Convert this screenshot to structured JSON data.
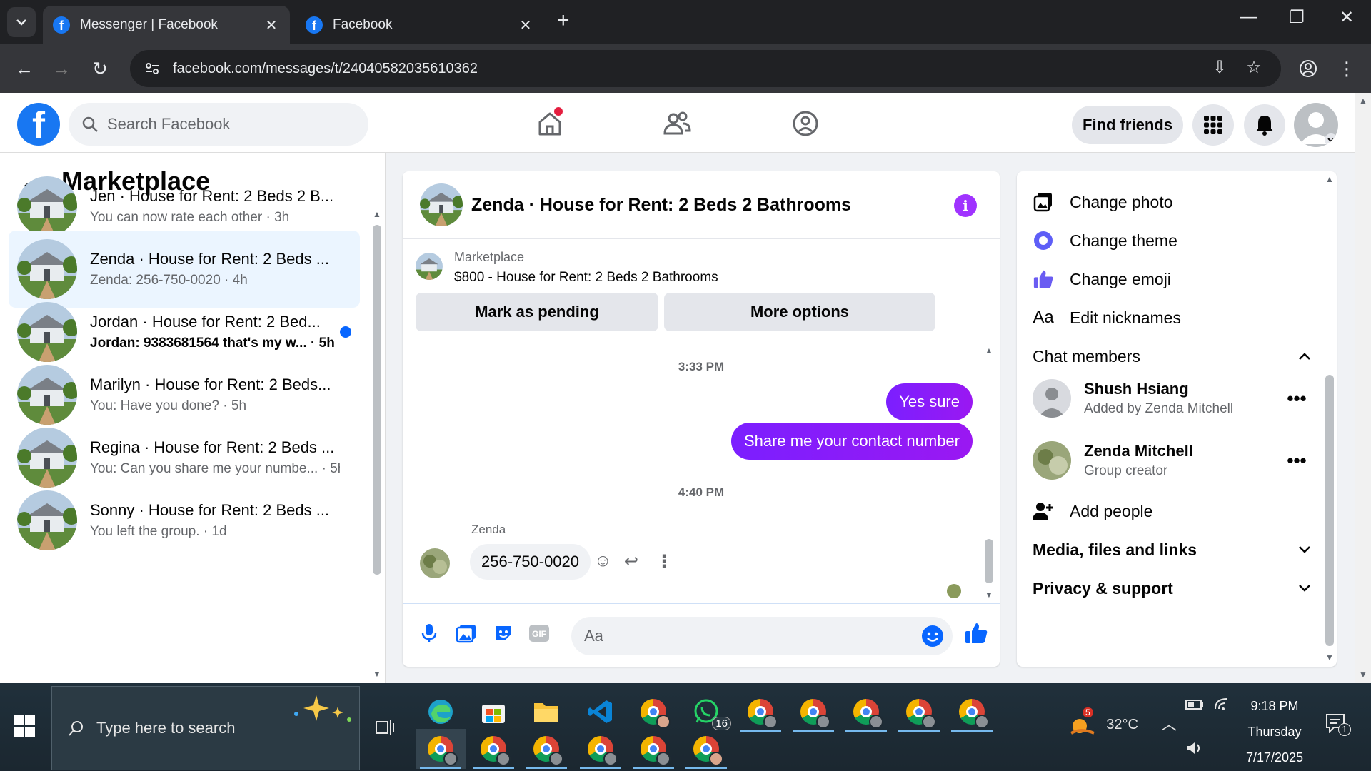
{
  "browser": {
    "tabs": [
      {
        "title": "Messenger | Facebook",
        "active": true
      },
      {
        "title": "Facebook",
        "active": false
      }
    ],
    "url": "facebook.com/messages/t/24040582035610362",
    "favicon_letter": "f"
  },
  "fb_header": {
    "logo_letter": "f",
    "search_placeholder": "Search Facebook",
    "find_friends_label": "Find friends"
  },
  "sidebar": {
    "title": "Marketplace",
    "conversations": [
      {
        "name": "Jen · House for Rent: 2 Beds 2 B...",
        "preview": "You can now rate each other · 3h",
        "selected": false,
        "unread": false
      },
      {
        "name": "Zenda · House for Rent: 2 Beds ...",
        "preview": "Zenda: 256-750-0020 · 4h",
        "selected": true,
        "unread": false
      },
      {
        "name": "Jordan · House for Rent: 2 Bed...",
        "preview": "Jordan: 9383681564 that's my w... · 5h",
        "selected": false,
        "unread": true
      },
      {
        "name": "Marilyn · House for Rent: 2 Beds...",
        "preview": "You: Have you done? · 5h",
        "selected": false,
        "unread": false
      },
      {
        "name": "Regina · House for Rent: 2 Beds ...",
        "preview": "You: Can you share me your numbe... · 5h",
        "selected": false,
        "unread": false
      },
      {
        "name": "Sonny · House for Rent: 2 Beds ...",
        "preview": "You left the group. · 1d",
        "selected": false,
        "unread": false
      }
    ]
  },
  "chat": {
    "title": "Zenda · House for Rent: 2 Beds 2 Bathrooms",
    "marketplace_label": "Marketplace",
    "listing": "$800 - House for Rent: 2 Beds 2 Bathrooms",
    "mark_pending_label": "Mark as pending",
    "more_options_label": "More options",
    "timestamp1": "3:33 PM",
    "out_msg1": "Yes sure",
    "out_msg2": "Share me your contact number",
    "timestamp2": "4:40 PM",
    "sender_name": "Zenda",
    "in_msg": "256-750-0020",
    "composer_placeholder": "Aa"
  },
  "right_panel": {
    "change_photo": "Change photo",
    "change_theme": "Change theme",
    "change_emoji": "Change emoji",
    "edit_nicknames": "Edit nicknames",
    "chat_members": "Chat members",
    "members": [
      {
        "name": "Shush Hsiang",
        "role": "Added by Zenda Mitchell"
      },
      {
        "name": "Zenda Mitchell",
        "role": "Group creator"
      }
    ],
    "add_people": "Add people",
    "media_files": "Media, files and links",
    "privacy_support": "Privacy & support",
    "aa_glyph": "Aa"
  },
  "taskbar": {
    "search_placeholder": "Type here to search",
    "whatsapp_badge": "16",
    "weather_temp": "32°C",
    "weather_badge": "5",
    "clock_time": "9:18 PM",
    "clock_day": "Thursday",
    "clock_date": "7/17/2025",
    "notification_count": "1"
  },
  "colors": {
    "fb_blue": "#1877f2",
    "messenger_purple": "#8a0af0",
    "selected_bg": "#ebf5ff"
  }
}
